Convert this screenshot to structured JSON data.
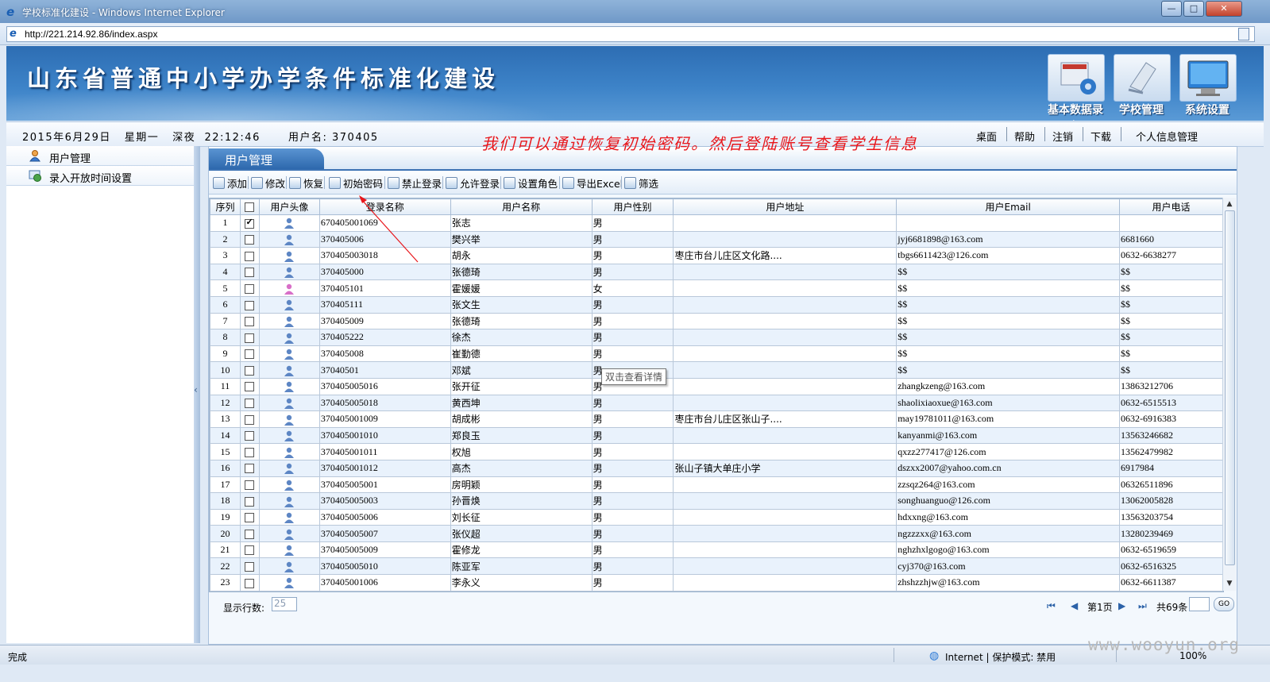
{
  "window": {
    "title": "学校标准化建设 - Windows Internet Explorer",
    "minimize": "—",
    "maximize": "□",
    "close": "✕"
  },
  "address": {
    "url": "http://221.214.92.86/index.aspx"
  },
  "banner": {
    "title": "山东省普通中小学办学条件标准化建设"
  },
  "modules": [
    {
      "label": "基本数据录入",
      "icon": "data-entry-icon"
    },
    {
      "label": "学校管理",
      "icon": "school-manage-icon"
    },
    {
      "label": "系统设置",
      "icon": "monitor-icon"
    }
  ],
  "infobar": {
    "datetime": "2015年6月29日   星期一   深夜  22:12:46",
    "username": "用户名: 370405",
    "links": [
      "桌面",
      "帮助",
      "注销",
      "下载",
      "个人信息管理"
    ]
  },
  "nav": [
    {
      "label": "用户管理",
      "icon": "user-icon"
    },
    {
      "label": "录入开放时间设置",
      "icon": "clock-settings-icon"
    }
  ],
  "panel": {
    "tab_title": "用户管理"
  },
  "toolbar": [
    "添加",
    "修改",
    "恢复",
    "初始密码",
    "禁止登录",
    "允许登录",
    "设置角色",
    "导出Excel",
    "筛选"
  ],
  "grid": {
    "headers": [
      "序列",
      "",
      "用户头像",
      "登录名称",
      "用户名称",
      "用户性别",
      "用户地址",
      "用户Email",
      "用户电话"
    ],
    "rows": [
      {
        "no": "1",
        "checked": true,
        "female": false,
        "login": "670405001069",
        "name": "张志",
        "sex": "男",
        "addr": "",
        "email": "",
        "phone": ""
      },
      {
        "no": "2",
        "checked": false,
        "female": false,
        "login": "370405006",
        "name": "樊兴举",
        "sex": "男",
        "addr": "",
        "email": "jyj6681898@163.com",
        "phone": "6681660"
      },
      {
        "no": "3",
        "checked": false,
        "female": false,
        "login": "370405003018",
        "name": "胡永",
        "sex": "男",
        "addr": "枣庄市台儿庄区文化路....",
        "email": "tbgs6611423@126.com",
        "phone": "0632-6638277"
      },
      {
        "no": "4",
        "checked": false,
        "female": false,
        "login": "370405000",
        "name": "张德琦",
        "sex": "男",
        "addr": "",
        "email": "$$",
        "phone": "$$"
      },
      {
        "no": "5",
        "checked": false,
        "female": true,
        "login": "370405101",
        "name": "霍媛媛",
        "sex": "女",
        "addr": "",
        "email": "$$",
        "phone": "$$"
      },
      {
        "no": "6",
        "checked": false,
        "female": false,
        "login": "370405111",
        "name": "张文生",
        "sex": "男",
        "addr": "",
        "email": "$$",
        "phone": "$$"
      },
      {
        "no": "7",
        "checked": false,
        "female": false,
        "login": "370405009",
        "name": "张德琦",
        "sex": "男",
        "addr": "",
        "email": "$$",
        "phone": "$$"
      },
      {
        "no": "8",
        "checked": false,
        "female": false,
        "login": "370405222",
        "name": "徐杰",
        "sex": "男",
        "addr": "",
        "email": "$$",
        "phone": "$$"
      },
      {
        "no": "9",
        "checked": false,
        "female": false,
        "login": "370405008",
        "name": "崔勤德",
        "sex": "男",
        "addr": "",
        "email": "$$",
        "phone": "$$"
      },
      {
        "no": "10",
        "checked": false,
        "female": false,
        "login": "37040501",
        "name": "邓斌",
        "sex": "男",
        "addr": "",
        "email": "$$",
        "phone": "$$"
      },
      {
        "no": "11",
        "checked": false,
        "female": false,
        "login": "370405005016",
        "name": "张开征",
        "sex": "男",
        "addr": "",
        "email": "zhangkzeng@163.com",
        "phone": "13863212706"
      },
      {
        "no": "12",
        "checked": false,
        "female": false,
        "login": "370405005018",
        "name": "黄西坤",
        "sex": "男",
        "addr": "",
        "email": "shaolixiaoxue@163.com",
        "phone": "0632-6515513"
      },
      {
        "no": "13",
        "checked": false,
        "female": false,
        "login": "370405001009",
        "name": "胡成彬",
        "sex": "男",
        "addr": "枣庄市台儿庄区张山子....",
        "email": "may19781011@163.com",
        "phone": "0632-6916383"
      },
      {
        "no": "14",
        "checked": false,
        "female": false,
        "login": "370405001010",
        "name": "郑良玉",
        "sex": "男",
        "addr": "",
        "email": "kanyanmi@163.com",
        "phone": "13563246682"
      },
      {
        "no": "15",
        "checked": false,
        "female": false,
        "login": "370405001011",
        "name": "权旭",
        "sex": "男",
        "addr": "",
        "email": "qxzz277417@126.com",
        "phone": "13562479982"
      },
      {
        "no": "16",
        "checked": false,
        "female": false,
        "login": "370405001012",
        "name": "高杰",
        "sex": "男",
        "addr": "张山子镇大单庄小学",
        "email": "dszxx2007@yahoo.com.cn",
        "phone": "6917984"
      },
      {
        "no": "17",
        "checked": false,
        "female": false,
        "login": "370405005001",
        "name": "房明颖",
        "sex": "男",
        "addr": "",
        "email": "zzsqz264@163.com",
        "phone": "06326511896"
      },
      {
        "no": "18",
        "checked": false,
        "female": false,
        "login": "370405005003",
        "name": "孙晋焕",
        "sex": "男",
        "addr": "",
        "email": "songhuanguo@126.com",
        "phone": "13062005828"
      },
      {
        "no": "19",
        "checked": false,
        "female": false,
        "login": "370405005006",
        "name": "刘长征",
        "sex": "男",
        "addr": "",
        "email": "hdxxng@163.com",
        "phone": "13563203754"
      },
      {
        "no": "20",
        "checked": false,
        "female": false,
        "login": "370405005007",
        "name": "张仪超",
        "sex": "男",
        "addr": "",
        "email": "ngzzzxx@163.com",
        "phone": "13280239469"
      },
      {
        "no": "21",
        "checked": false,
        "female": false,
        "login": "370405005009",
        "name": "霍修龙",
        "sex": "男",
        "addr": "",
        "email": "nghzhxlgogo@163.com",
        "phone": "0632-6519659"
      },
      {
        "no": "22",
        "checked": false,
        "female": false,
        "login": "370405005010",
        "name": "陈亚军",
        "sex": "男",
        "addr": "",
        "email": "cyj370@163.com",
        "phone": "0632-6516325"
      },
      {
        "no": "23",
        "checked": false,
        "female": false,
        "login": "370405001006",
        "name": "李永义",
        "sex": "男",
        "addr": "",
        "email": "zhshzzhjw@163.com",
        "phone": "0632-6611387"
      }
    ]
  },
  "pager": {
    "rows_label": "显示行数:",
    "rows_value": "25",
    "page": "第1页",
    "total": "共69条",
    "go": "GO"
  },
  "annotation": "我们可以通过恢复初始密码。然后登陆账号查看学生信息",
  "tooltip": "双击查看详情",
  "status": {
    "left": "完成",
    "zone": "Internet | 保护模式: 禁用",
    "zoom": "100%"
  },
  "watermark": "www.wooyun.org",
  "colors": {
    "banner": "#3d83c8",
    "annotation": "#e8161b",
    "row_alt": "#e9f2fc",
    "tab": "#2d68ad"
  }
}
